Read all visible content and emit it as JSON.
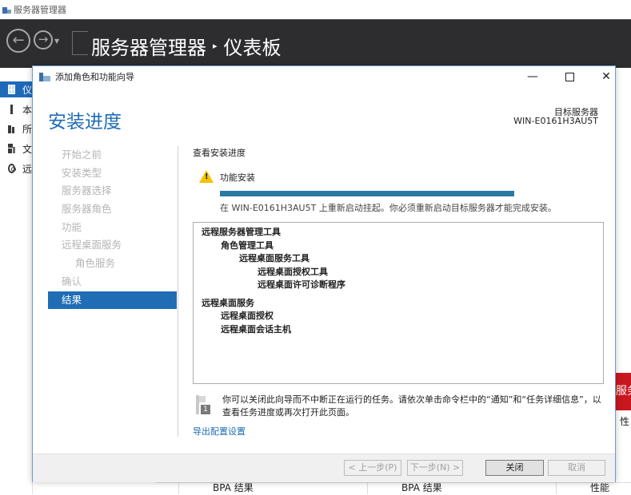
{
  "app": {
    "title": "服务器管理器"
  },
  "header": {
    "breadcrumb_root": "服务器管理器",
    "breadcrumb_separator": "▸",
    "breadcrumb_current": "仪表板"
  },
  "sidebar": {
    "items": [
      {
        "label": "仪",
        "icon": "dashboard-icon",
        "active": true
      },
      {
        "label": "本",
        "icon": "local-server-icon"
      },
      {
        "label": "所",
        "icon": "all-servers-icon"
      },
      {
        "label": "文",
        "icon": "file-services-icon"
      },
      {
        "label": "远",
        "icon": "remote-desktop-icon"
      }
    ]
  },
  "background": {
    "tile_fragment": "服务",
    "perf_fragment": "性",
    "bpa_label_1": "BPA 结果",
    "bpa_label_2": "BPA 结果",
    "perf_label": "性能",
    "accent_color": "#c9171f"
  },
  "wizard": {
    "title": "添加角色和功能向导",
    "heading": "安装进度",
    "target_label": "目标服务器",
    "target_name": "WIN-E0161H3AU5T",
    "steps": [
      {
        "label": "开始之前"
      },
      {
        "label": "安装类型"
      },
      {
        "label": "服务器选择"
      },
      {
        "label": "服务器角色"
      },
      {
        "label": "功能"
      },
      {
        "label": "远程桌面服务"
      },
      {
        "label": "角色服务"
      },
      {
        "label": "确认"
      },
      {
        "label": "结果"
      }
    ],
    "content_title": "查看安装进度",
    "feature_label": "功能安装",
    "progress": 1.0,
    "restart_message": "在 WIN-E0161H3AU5T 上重新启动挂起。你必须重新启动目标服务器才能完成安装。",
    "results": [
      "远程服务器管理工具",
      "角色管理工具",
      "远程桌面服务工具",
      "远程桌面授权工具",
      "远程桌面许可诊断程序",
      "远程桌面服务",
      "远程桌面授权",
      "远程桌面会话主机"
    ],
    "info_badge": "1",
    "info_text": "你可以关闭此向导而不中断正在运行的任务。请依次单击命令栏中的“通知”和“任务详细信息”，以查看任务进度或再次打开此页面。",
    "export_link": "导出配置设置",
    "buttons": {
      "prev": "< 上一步(P)",
      "next": "下一步(N) >",
      "close": "关闭",
      "cancel": "取消"
    },
    "window_controls": {
      "minimize": "—",
      "close": "✕"
    }
  }
}
